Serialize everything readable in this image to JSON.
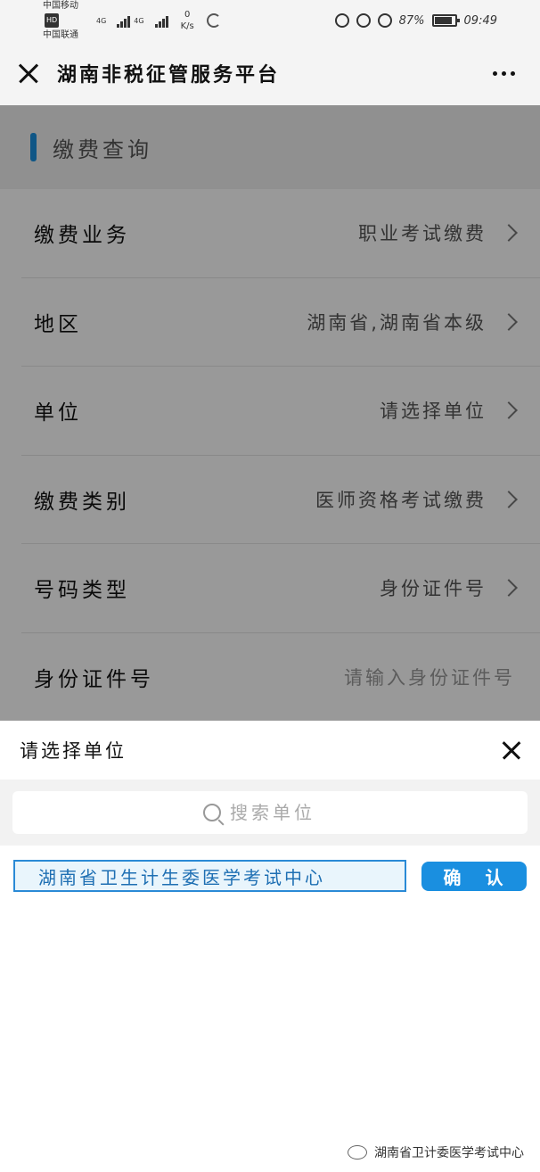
{
  "status_bar": {
    "carrier_1": "中国移动",
    "carrier_1_badge": "HD",
    "carrier_2": "中国联通",
    "network_1": "4G",
    "network_2": "4G",
    "speed_value": "0",
    "speed_unit": "K/s",
    "battery": "87%",
    "time": "09:49"
  },
  "title_bar": {
    "title": "湖南非税征管服务平台"
  },
  "form": {
    "section_title": "缴费查询",
    "rows": [
      {
        "label": "缴费业务",
        "value": "职业考试缴费"
      },
      {
        "label": "地区",
        "value": "湖南省,湖南省本级"
      },
      {
        "label": "单位",
        "value": "请选择单位"
      },
      {
        "label": "缴费类别",
        "value": "医师资格考试缴费"
      },
      {
        "label": "号码类型",
        "value": "身份证件号"
      },
      {
        "label": "身份证件号",
        "value": "请输入身份证件号"
      }
    ]
  },
  "sheet": {
    "title": "请选择单位",
    "search_placeholder": "搜索单位",
    "result": "湖南省卫生计生委医学考试中心",
    "confirm_label": "确 认"
  },
  "watermark": {
    "text": "湖南省卫计委医学考试中心"
  },
  "colors": {
    "accent": "#1a8fe0",
    "selected_bg": "#e9f5fc",
    "overlay": "rgba(0,0,0,0.40)"
  }
}
